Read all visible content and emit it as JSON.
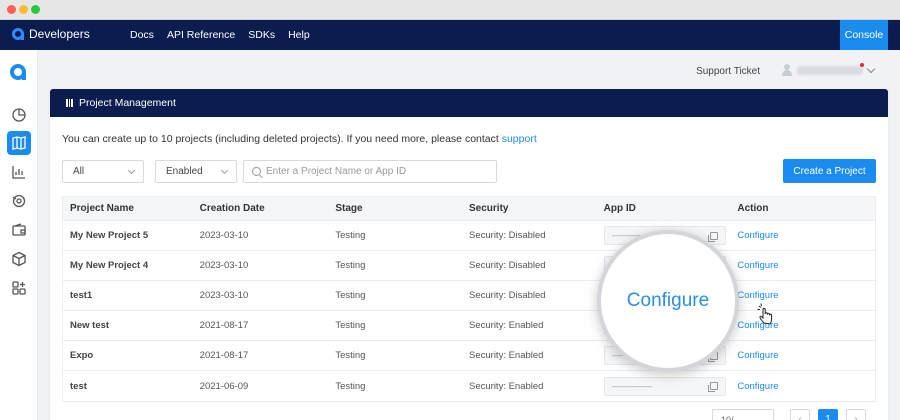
{
  "nav": {
    "brand": "Developers",
    "links": [
      "Docs",
      "API Reference",
      "SDKs",
      "Help"
    ],
    "console": "Console"
  },
  "header": {
    "support_ticket": "Support Ticket"
  },
  "card": {
    "title": "Project Management",
    "notice_text": "You can create up to 10 projects (including deleted projects). If you need more, please contact ",
    "notice_link": "support"
  },
  "filters": {
    "type_value": "All",
    "status_value": "Enabled",
    "search_placeholder": "Enter a Project Name or App ID",
    "create_button": "Create a Project"
  },
  "table": {
    "columns": [
      "Project Name",
      "Creation Date",
      "Stage",
      "Security",
      "App ID",
      "Action"
    ],
    "rows": [
      {
        "name": "My New Project 5",
        "date": "2023-03-10",
        "stage": "Testing",
        "security": "Security: Disabled",
        "action": "Configure"
      },
      {
        "name": "My New Project 4",
        "date": "2023-03-10",
        "stage": "Testing",
        "security": "Security: Disabled",
        "action": "Configure"
      },
      {
        "name": "test1",
        "date": "2023-03-10",
        "stage": "Testing",
        "security": "Security: Disabled",
        "action": "Configure"
      },
      {
        "name": "New test",
        "date": "2021-08-17",
        "stage": "Testing",
        "security": "Security: Enabled",
        "action": "Configure"
      },
      {
        "name": "Expo",
        "date": "2021-08-17",
        "stage": "Testing",
        "security": "Security: Enabled",
        "action": "Configure"
      },
      {
        "name": "test",
        "date": "2021-06-09",
        "stage": "Testing",
        "security": "Security: Enabled",
        "action": "Configure"
      }
    ]
  },
  "pagination": {
    "page_size": "10/...",
    "prev": "‹",
    "current": "1",
    "next": "›"
  },
  "magnifier": {
    "text": "Configure"
  },
  "colors": {
    "nav_bg": "#0b1d4f",
    "accent": "#1a8cf0"
  },
  "icons": {
    "rail": [
      "dashboard-icon",
      "projects-map-icon",
      "analytics-icon",
      "monitor-icon",
      "billing-wallet-icon",
      "package-box-icon",
      "apps-grid-icon"
    ]
  }
}
